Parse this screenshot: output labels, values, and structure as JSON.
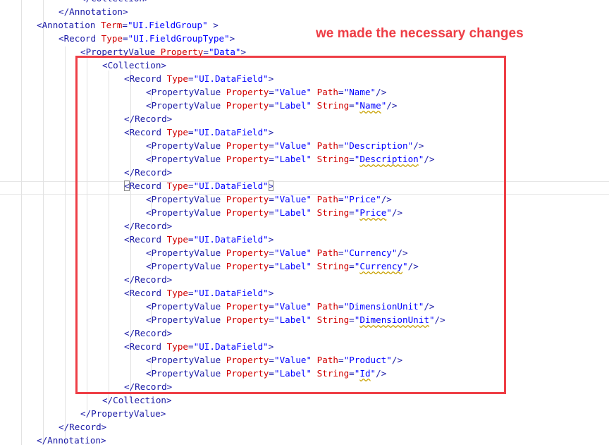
{
  "note": "we made the necessary changes",
  "accent_color": "#ee3e46",
  "code_lines": [
    {
      "indent": 4,
      "tokens": [
        {
          "t": "b",
          "s": "</Collection>"
        }
      ]
    },
    {
      "indent": 3,
      "tokens": [
        {
          "t": "b",
          "s": "</Annotation>"
        }
      ]
    },
    {
      "indent": 2,
      "tokens": [
        {
          "t": "b",
          "s": "<Annotation "
        },
        {
          "t": "a",
          "s": "Term"
        },
        {
          "t": "b",
          "s": "="
        },
        {
          "t": "v",
          "s": "\"UI.FieldGroup\""
        },
        {
          "t": "b",
          "s": " >"
        }
      ]
    },
    {
      "indent": 3,
      "tokens": [
        {
          "t": "b",
          "s": "<Record "
        },
        {
          "t": "a",
          "s": "Type"
        },
        {
          "t": "b",
          "s": "="
        },
        {
          "t": "v",
          "s": "\"UI.FieldGroupType\""
        },
        {
          "t": "b",
          "s": ">"
        }
      ]
    },
    {
      "indent": 4,
      "tokens": [
        {
          "t": "b",
          "s": "<PropertyValue "
        },
        {
          "t": "a",
          "s": "Property"
        },
        {
          "t": "b",
          "s": "="
        },
        {
          "t": "v",
          "s": "\"Data\""
        },
        {
          "t": "b",
          "s": ">"
        }
      ]
    },
    {
      "indent": 5,
      "tokens": [
        {
          "t": "b",
          "s": "<Collection>"
        }
      ]
    },
    {
      "indent": 6,
      "tokens": [
        {
          "t": "b",
          "s": "<Record "
        },
        {
          "t": "a",
          "s": "Type"
        },
        {
          "t": "b",
          "s": "="
        },
        {
          "t": "v",
          "s": "\"UI.DataField\""
        },
        {
          "t": "b",
          "s": ">"
        }
      ]
    },
    {
      "indent": 7,
      "tokens": [
        {
          "t": "b",
          "s": "<PropertyValue "
        },
        {
          "t": "a",
          "s": "Property"
        },
        {
          "t": "b",
          "s": "="
        },
        {
          "t": "v",
          "s": "\"Value\""
        },
        {
          "t": "b",
          "s": " "
        },
        {
          "t": "a",
          "s": "Path"
        },
        {
          "t": "b",
          "s": "="
        },
        {
          "t": "v",
          "s": "\"Name\""
        },
        {
          "t": "b",
          "s": "/>"
        }
      ]
    },
    {
      "indent": 7,
      "tokens": [
        {
          "t": "b",
          "s": "<PropertyValue "
        },
        {
          "t": "a",
          "s": "Property"
        },
        {
          "t": "b",
          "s": "="
        },
        {
          "t": "v",
          "s": "\"Label\""
        },
        {
          "t": "b",
          "s": " "
        },
        {
          "t": "a",
          "s": "String"
        },
        {
          "t": "b",
          "s": "="
        },
        {
          "t": "v",
          "s": "\""
        },
        {
          "t": "vs",
          "s": "Name"
        },
        {
          "t": "v",
          "s": "\""
        },
        {
          "t": "b",
          "s": "/>"
        }
      ]
    },
    {
      "indent": 6,
      "tokens": [
        {
          "t": "b",
          "s": "</Record>"
        }
      ]
    },
    {
      "indent": 6,
      "tokens": [
        {
          "t": "b",
          "s": "<Record "
        },
        {
          "t": "a",
          "s": "Type"
        },
        {
          "t": "b",
          "s": "="
        },
        {
          "t": "v",
          "s": "\"UI.DataField\""
        },
        {
          "t": "b",
          "s": ">"
        }
      ]
    },
    {
      "indent": 7,
      "tokens": [
        {
          "t": "b",
          "s": "<PropertyValue "
        },
        {
          "t": "a",
          "s": "Property"
        },
        {
          "t": "b",
          "s": "="
        },
        {
          "t": "v",
          "s": "\"Value\""
        },
        {
          "t": "b",
          "s": " "
        },
        {
          "t": "a",
          "s": "Path"
        },
        {
          "t": "b",
          "s": "="
        },
        {
          "t": "v",
          "s": "\"Description\""
        },
        {
          "t": "b",
          "s": "/>"
        }
      ]
    },
    {
      "indent": 7,
      "tokens": [
        {
          "t": "b",
          "s": "<PropertyValue "
        },
        {
          "t": "a",
          "s": "Property"
        },
        {
          "t": "b",
          "s": "="
        },
        {
          "t": "v",
          "s": "\"Label\""
        },
        {
          "t": "b",
          "s": " "
        },
        {
          "t": "a",
          "s": "String"
        },
        {
          "t": "b",
          "s": "="
        },
        {
          "t": "v",
          "s": "\""
        },
        {
          "t": "vs",
          "s": "Description"
        },
        {
          "t": "v",
          "s": "\""
        },
        {
          "t": "b",
          "s": "/>"
        }
      ]
    },
    {
      "indent": 6,
      "tokens": [
        {
          "t": "b",
          "s": "</Record>"
        }
      ]
    },
    {
      "indent": 6,
      "tokens": [
        {
          "t": "bm",
          "s": "<"
        },
        {
          "t": "b",
          "s": "Record "
        },
        {
          "t": "a",
          "s": "Type"
        },
        {
          "t": "b",
          "s": "="
        },
        {
          "t": "v",
          "s": "\"UI.DataField\""
        },
        {
          "t": "bm",
          "s": ">"
        }
      ]
    },
    {
      "indent": 7,
      "tokens": [
        {
          "t": "b",
          "s": "<PropertyValue "
        },
        {
          "t": "a",
          "s": "Property"
        },
        {
          "t": "b",
          "s": "="
        },
        {
          "t": "v",
          "s": "\"Value\""
        },
        {
          "t": "b",
          "s": " "
        },
        {
          "t": "a",
          "s": "Path"
        },
        {
          "t": "b",
          "s": "="
        },
        {
          "t": "v",
          "s": "\"Price\""
        },
        {
          "t": "b",
          "s": "/>"
        }
      ]
    },
    {
      "indent": 7,
      "tokens": [
        {
          "t": "b",
          "s": "<PropertyValue "
        },
        {
          "t": "a",
          "s": "Property"
        },
        {
          "t": "b",
          "s": "="
        },
        {
          "t": "v",
          "s": "\"Label\""
        },
        {
          "t": "b",
          "s": " "
        },
        {
          "t": "a",
          "s": "String"
        },
        {
          "t": "b",
          "s": "="
        },
        {
          "t": "v",
          "s": "\""
        },
        {
          "t": "vs",
          "s": "Price"
        },
        {
          "t": "v",
          "s": "\""
        },
        {
          "t": "b",
          "s": "/>"
        }
      ]
    },
    {
      "indent": 6,
      "tokens": [
        {
          "t": "b",
          "s": "</Record>"
        }
      ]
    },
    {
      "indent": 6,
      "tokens": [
        {
          "t": "b",
          "s": "<Record "
        },
        {
          "t": "a",
          "s": "Type"
        },
        {
          "t": "b",
          "s": "="
        },
        {
          "t": "v",
          "s": "\"UI.DataField\""
        },
        {
          "t": "b",
          "s": ">"
        }
      ]
    },
    {
      "indent": 7,
      "tokens": [
        {
          "t": "b",
          "s": "<PropertyValue "
        },
        {
          "t": "a",
          "s": "Property"
        },
        {
          "t": "b",
          "s": "="
        },
        {
          "t": "v",
          "s": "\"Value\""
        },
        {
          "t": "b",
          "s": " "
        },
        {
          "t": "a",
          "s": "Path"
        },
        {
          "t": "b",
          "s": "="
        },
        {
          "t": "v",
          "s": "\"Currency\""
        },
        {
          "t": "b",
          "s": "/>"
        }
      ]
    },
    {
      "indent": 7,
      "tokens": [
        {
          "t": "b",
          "s": "<PropertyValue "
        },
        {
          "t": "a",
          "s": "Property"
        },
        {
          "t": "b",
          "s": "="
        },
        {
          "t": "v",
          "s": "\"Label\""
        },
        {
          "t": "b",
          "s": " "
        },
        {
          "t": "a",
          "s": "String"
        },
        {
          "t": "b",
          "s": "="
        },
        {
          "t": "v",
          "s": "\""
        },
        {
          "t": "vs",
          "s": "Currency"
        },
        {
          "t": "v",
          "s": "\""
        },
        {
          "t": "b",
          "s": "/>"
        }
      ]
    },
    {
      "indent": 6,
      "tokens": [
        {
          "t": "b",
          "s": "</Record>"
        }
      ]
    },
    {
      "indent": 6,
      "tokens": [
        {
          "t": "b",
          "s": "<Record "
        },
        {
          "t": "a",
          "s": "Type"
        },
        {
          "t": "b",
          "s": "="
        },
        {
          "t": "v",
          "s": "\"UI.DataField\""
        },
        {
          "t": "b",
          "s": ">"
        }
      ]
    },
    {
      "indent": 7,
      "tokens": [
        {
          "t": "b",
          "s": "<PropertyValue "
        },
        {
          "t": "a",
          "s": "Property"
        },
        {
          "t": "b",
          "s": "="
        },
        {
          "t": "v",
          "s": "\"Value\""
        },
        {
          "t": "b",
          "s": " "
        },
        {
          "t": "a",
          "s": "Path"
        },
        {
          "t": "b",
          "s": "="
        },
        {
          "t": "v",
          "s": "\"DimensionUnit\""
        },
        {
          "t": "b",
          "s": "/>"
        }
      ]
    },
    {
      "indent": 7,
      "tokens": [
        {
          "t": "b",
          "s": "<PropertyValue "
        },
        {
          "t": "a",
          "s": "Property"
        },
        {
          "t": "b",
          "s": "="
        },
        {
          "t": "v",
          "s": "\"Label\""
        },
        {
          "t": "b",
          "s": " "
        },
        {
          "t": "a",
          "s": "String"
        },
        {
          "t": "b",
          "s": "="
        },
        {
          "t": "v",
          "s": "\""
        },
        {
          "t": "vs",
          "s": "DimensionUnit"
        },
        {
          "t": "v",
          "s": "\""
        },
        {
          "t": "b",
          "s": "/>"
        }
      ]
    },
    {
      "indent": 6,
      "tokens": [
        {
          "t": "b",
          "s": "</Record>"
        }
      ]
    },
    {
      "indent": 6,
      "tokens": [
        {
          "t": "b",
          "s": "<Record "
        },
        {
          "t": "a",
          "s": "Type"
        },
        {
          "t": "b",
          "s": "="
        },
        {
          "t": "v",
          "s": "\"UI.DataField\""
        },
        {
          "t": "b",
          "s": ">"
        }
      ]
    },
    {
      "indent": 7,
      "tokens": [
        {
          "t": "b",
          "s": "<PropertyValue "
        },
        {
          "t": "a",
          "s": "Property"
        },
        {
          "t": "b",
          "s": "="
        },
        {
          "t": "v",
          "s": "\"Value\""
        },
        {
          "t": "b",
          "s": " "
        },
        {
          "t": "a",
          "s": "Path"
        },
        {
          "t": "b",
          "s": "="
        },
        {
          "t": "v",
          "s": "\"Product\""
        },
        {
          "t": "b",
          "s": "/>"
        }
      ]
    },
    {
      "indent": 7,
      "tokens": [
        {
          "t": "b",
          "s": "<PropertyValue "
        },
        {
          "t": "a",
          "s": "Property"
        },
        {
          "t": "b",
          "s": "="
        },
        {
          "t": "v",
          "s": "\"Label\""
        },
        {
          "t": "b",
          "s": " "
        },
        {
          "t": "a",
          "s": "String"
        },
        {
          "t": "b",
          "s": "="
        },
        {
          "t": "v",
          "s": "\""
        },
        {
          "t": "vs",
          "s": "Id"
        },
        {
          "t": "v",
          "s": "\""
        },
        {
          "t": "b",
          "s": "/>"
        }
      ]
    },
    {
      "indent": 6,
      "tokens": [
        {
          "t": "b",
          "s": "</Record>"
        }
      ]
    },
    {
      "indent": 5,
      "tokens": [
        {
          "t": "b",
          "s": "</Collection>"
        }
      ]
    },
    {
      "indent": 4,
      "tokens": [
        {
          "t": "b",
          "s": "</PropertyValue>"
        }
      ]
    },
    {
      "indent": 3,
      "tokens": [
        {
          "t": "b",
          "s": "</Record>"
        }
      ]
    },
    {
      "indent": 2,
      "tokens": [
        {
          "t": "b",
          "s": "</Annotation>"
        }
      ]
    }
  ]
}
